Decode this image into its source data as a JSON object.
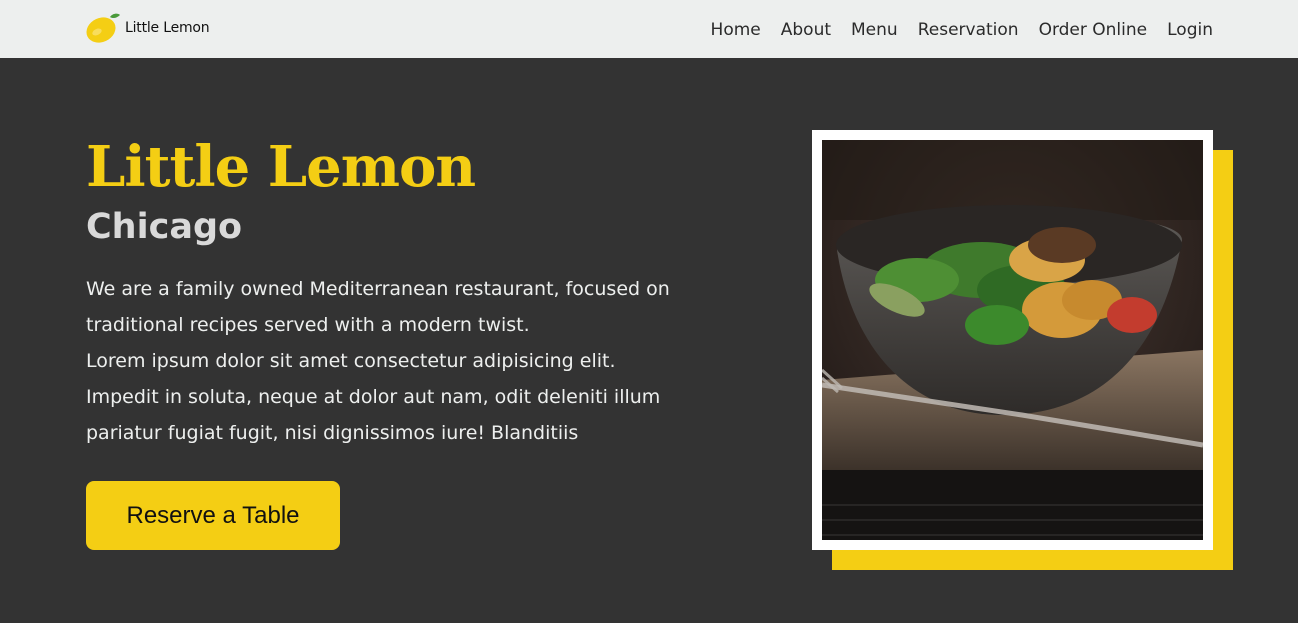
{
  "nav": {
    "logo": {
      "icon": "lemon-icon",
      "text": "Little Lemon"
    },
    "links": [
      "Home",
      "About",
      "Menu",
      "Reservation",
      "Order Online",
      "Login"
    ]
  },
  "hero": {
    "title": "Little Lemon",
    "subtitle": "Chicago",
    "description": [
      "We are a family owned Mediterranean restaurant, focused on",
      "traditional recipes served with a modern twist.",
      "Lorem ipsum dolor sit amet consectetur adipisicing elit.",
      "Impedit in soluta, neque at dolor aut nam, odit deleniti illum",
      "pariatur fugiat fugit, nisi dignissimos iure! Blanditiis"
    ],
    "cta": "Reserve a Table",
    "image": "salad-bowl-photo"
  },
  "colors": {
    "primary_yellow": "#f4ce14",
    "dark_bg": "#333333",
    "nav_bg": "#edefee",
    "subtitle": "#d9d9d9",
    "text_light": "#edefee"
  }
}
